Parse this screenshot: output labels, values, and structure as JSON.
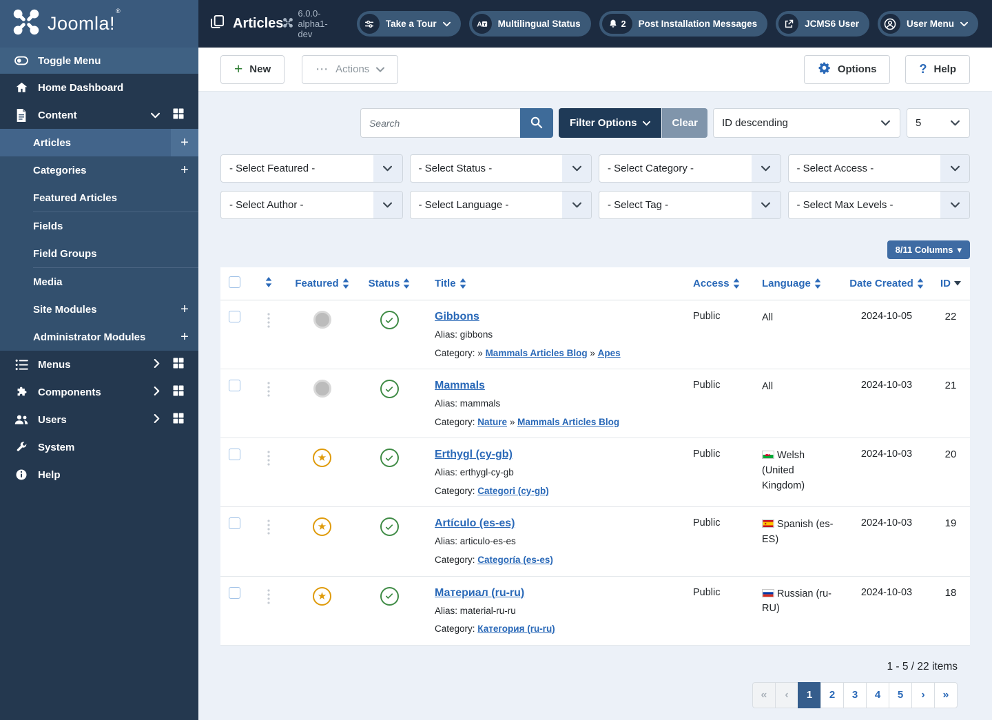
{
  "brand": {
    "name": "Joomla!",
    "trademark": "®"
  },
  "colors": {
    "header_bg": "#1c2b40",
    "sidebar_bg": "#24384f",
    "sidebar_logo_bg": "#3a5a7d",
    "sidebar_toggle_bg": "#3f6183",
    "submenu_bg": "#33506e",
    "submenu_active_bg": "#42648a",
    "pill_bg": "#3b5977",
    "link_blue": "#2a69b8",
    "button_navy": "#1f3a57",
    "button_steel": "#3e6b99",
    "button_gray_blue": "#8095ab",
    "columns_btn_bg": "#3e6ba3",
    "page_active_bg": "#355d8c",
    "featured_amber": "#df9b0b",
    "published_green": "#3f8b45",
    "content_bg": "#ecf1f8"
  },
  "icons": {
    "plus": "+",
    "star": "★",
    "ellipsis": "⋯",
    "caret_down": "▾",
    "first_page": "«",
    "prev_page": "‹",
    "next_page": "›",
    "last_page": "»"
  },
  "sidebar": {
    "toggle_label": "Toggle Menu",
    "home": "Home Dashboard",
    "content": "Content",
    "submenu": [
      "Articles",
      "Categories",
      "Featured Articles",
      "Fields",
      "Field Groups",
      "Media",
      "Site Modules",
      "Administrator Modules"
    ],
    "menus": "Menus",
    "components": "Components",
    "users": "Users",
    "system": "System",
    "help": "Help"
  },
  "topbar": {
    "title": "Articles",
    "version": "6.0.0-alpha1-dev",
    "pills": [
      {
        "label": "Take a Tour"
      },
      {
        "label": "Multilingual Status"
      },
      {
        "label": "Post Installation Messages",
        "badge": "2"
      },
      {
        "label": "JCMS6 User"
      },
      {
        "label": "User Menu"
      }
    ]
  },
  "toolbar": {
    "new": "New",
    "actions": "Actions",
    "options": "Options",
    "help": "Help"
  },
  "filterbar": {
    "search_placeholder": "Search",
    "filter_options": "Filter Options",
    "clear": "Clear",
    "sort_value": "ID descending",
    "limit_value": "5"
  },
  "filters": [
    "- Select Featured -",
    "- Select Status -",
    "- Select Category -",
    "- Select Access -",
    "- Select Author -",
    "- Select Language -",
    "- Select Tag -",
    "- Select Max Levels -"
  ],
  "columns_button": "8/11 Columns",
  "table": {
    "alias_label": "Alias:",
    "category_label": "Category:",
    "headers": [
      "Featured",
      "Status",
      "Title",
      "Access",
      "Language",
      "Date Created",
      "ID"
    ],
    "rows": [
      {
        "featured": false,
        "published": true,
        "title": "Gibbons",
        "alias": "gibbons",
        "category": [
          {
            "t": "» "
          },
          {
            "l": "Mammals Articles Blog"
          },
          {
            "t": " » "
          },
          {
            "l": "Apes"
          }
        ],
        "access": "Public",
        "language": {
          "text": "All"
        },
        "date": "2024-10-05",
        "id": "22"
      },
      {
        "featured": false,
        "published": true,
        "title": "Mammals",
        "alias": "mammals",
        "category": [
          {
            "l": "Nature"
          },
          {
            "t": " » "
          },
          {
            "l": "Mammals Articles Blog"
          }
        ],
        "access": "Public",
        "language": {
          "text": "All"
        },
        "date": "2024-10-03",
        "id": "21"
      },
      {
        "featured": true,
        "published": true,
        "title": "Erthygl (cy-gb)",
        "alias": "erthygl-cy-gb",
        "category": [
          {
            "l": "Categori (cy-gb)"
          }
        ],
        "access": "Public",
        "language": {
          "flag": "cy",
          "text": "Welsh (United Kingdom)"
        },
        "date": "2024-10-03",
        "id": "20"
      },
      {
        "featured": true,
        "published": true,
        "title": "Artículo (es-es)",
        "alias": "articulo-es-es",
        "category": [
          {
            "l": "Categoría (es-es)"
          }
        ],
        "access": "Public",
        "language": {
          "flag": "es",
          "text": "Spanish (es-ES)"
        },
        "date": "2024-10-03",
        "id": "19"
      },
      {
        "featured": true,
        "published": true,
        "title": "Материал (ru-ru)",
        "alias": "material-ru-ru",
        "category": [
          {
            "l": "Категория (ru-ru)"
          }
        ],
        "access": "Public",
        "language": {
          "flag": "ru",
          "text": "Russian (ru-RU)"
        },
        "date": "2024-10-03",
        "id": "18"
      }
    ]
  },
  "pagination": {
    "summary": "1 - 5 / 22 items",
    "pages": [
      "1",
      "2",
      "3",
      "4",
      "5"
    ],
    "active_page": "1"
  }
}
